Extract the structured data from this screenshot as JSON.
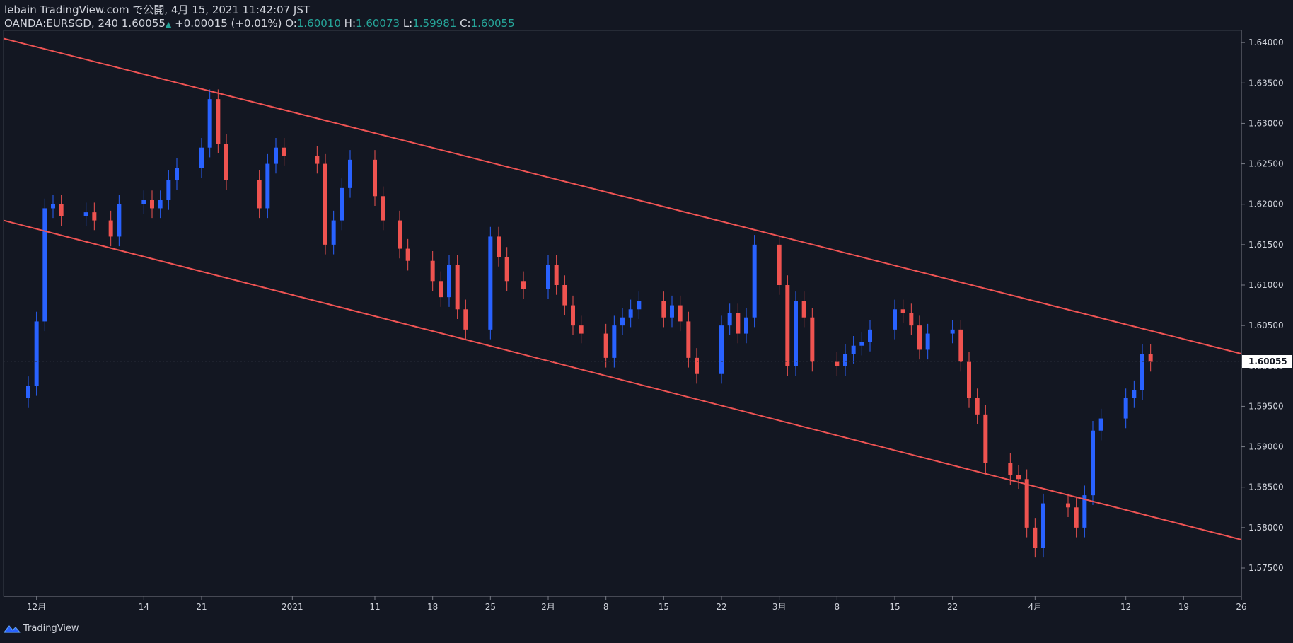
{
  "header": {
    "line1": "lebain TradingView.com で公開, 4月 15, 2021 11:42:07 JST",
    "symbol": "OANDA:EURSGD, 240",
    "last": "1.60055",
    "change": "+0.00015 (+0.01%)",
    "o_label": "O:",
    "o_value": "1.60010",
    "h_label": "H:",
    "h_value": "1.60073",
    "l_label": "L:",
    "l_value": "1.59981",
    "c_label": "C:",
    "c_value": "1.60055"
  },
  "footer": {
    "brand": "TradingView"
  },
  "colors": {
    "background": "#131722",
    "up": "#2962ff",
    "down": "#ef5350",
    "channel": "#f05454",
    "axis_text": "#d1d4dc",
    "price_tag": "#ffffff"
  },
  "chart_data": {
    "type": "line",
    "chart_style": "candlestick",
    "symbol": "OANDA:EURSGD",
    "timeframe": "240",
    "ylim": [
      1.5715,
      1.6415
    ],
    "y_ticks": [
      "1.64000",
      "1.63500",
      "1.63000",
      "1.62500",
      "1.62000",
      "1.61500",
      "1.61000",
      "1.60500",
      "1.60000",
      "1.59500",
      "1.59000",
      "1.58500",
      "1.58000",
      "1.57500"
    ],
    "y_tick_values": [
      1.64,
      1.635,
      1.63,
      1.625,
      1.62,
      1.615,
      1.61,
      1.605,
      1.6,
      1.595,
      1.59,
      1.585,
      1.58,
      1.575
    ],
    "x_ticks": [
      "12月",
      "14",
      "21",
      "2021",
      "11",
      "18",
      "25",
      "2月",
      "8",
      "15",
      "22",
      "3月",
      "8",
      "15",
      "22",
      "4月",
      "12",
      "19",
      "26"
    ],
    "x_tick_dates": [
      "2020-12-01",
      "2020-12-14",
      "2020-12-21",
      "2021-01-01",
      "2021-01-11",
      "2021-01-18",
      "2021-01-25",
      "2021-02-01",
      "2021-02-08",
      "2021-02-15",
      "2021-02-22",
      "2021-03-01",
      "2021-03-08",
      "2021-03-15",
      "2021-03-22",
      "2021-04-01",
      "2021-04-12",
      "2021-04-19",
      "2021-04-26"
    ],
    "current_price": "1.60055",
    "series": [
      {
        "name": "",
        "x": [
          "2020-11-30",
          "2020-12-01",
          "2020-12-02",
          "2020-12-03",
          "2020-12-04",
          "2020-12-07",
          "2020-12-08",
          "2020-12-10",
          "2020-12-11",
          "2020-12-14",
          "2020-12-15",
          "2020-12-16",
          "2020-12-17",
          "2020-12-18",
          "2020-12-21",
          "2020-12-22",
          "2020-12-23",
          "2020-12-24",
          "2020-12-28",
          "2020-12-29",
          "2020-12-30",
          "2020-12-31",
          "2021-01-04",
          "2021-01-05",
          "2021-01-06",
          "2021-01-07",
          "2021-01-08",
          "2021-01-11",
          "2021-01-12",
          "2021-01-14",
          "2021-01-15",
          "2021-01-18",
          "2021-01-19",
          "2021-01-20",
          "2021-01-21",
          "2021-01-22",
          "2021-01-25",
          "2021-01-26",
          "2021-01-27",
          "2021-01-29",
          "2021-02-01",
          "2021-02-02",
          "2021-02-03",
          "2021-02-04",
          "2021-02-05",
          "2021-02-08",
          "2021-02-09",
          "2021-02-10",
          "2021-02-11",
          "2021-02-12",
          "2021-02-15",
          "2021-02-16",
          "2021-02-17",
          "2021-02-18",
          "2021-02-19",
          "2021-02-22",
          "2021-02-23",
          "2021-02-24",
          "2021-02-25",
          "2021-02-26",
          "2021-03-01",
          "2021-03-02",
          "2021-03-03",
          "2021-03-04",
          "2021-03-05",
          "2021-03-08",
          "2021-03-09",
          "2021-03-10",
          "2021-03-11",
          "2021-03-12",
          "2021-03-15",
          "2021-03-16",
          "2021-03-17",
          "2021-03-18",
          "2021-03-19",
          "2021-03-22",
          "2021-03-23",
          "2021-03-24",
          "2021-03-25",
          "2021-03-26",
          "2021-03-29",
          "2021-03-30",
          "2021-03-31",
          "2021-04-01",
          "2021-04-02",
          "2021-04-05",
          "2021-04-06",
          "2021-04-07",
          "2021-04-08",
          "2021-04-09",
          "2021-04-12",
          "2021-04-13",
          "2021-04-14",
          "2021-04-15"
        ],
        "values": [
          1.5975,
          1.6055,
          1.6195,
          1.62,
          1.6185,
          1.619,
          1.618,
          1.616,
          1.62,
          1.6205,
          1.6195,
          1.6205,
          1.623,
          1.6245,
          1.627,
          1.633,
          1.6275,
          1.623,
          1.6195,
          1.625,
          1.627,
          1.626,
          1.625,
          1.615,
          1.618,
          1.622,
          1.6255,
          1.621,
          1.618,
          1.6145,
          1.613,
          1.6105,
          1.6085,
          1.6125,
          1.607,
          1.6045,
          1.616,
          1.6135,
          1.6105,
          1.6095,
          1.6125,
          1.61,
          1.6075,
          1.605,
          1.604,
          1.601,
          1.605,
          1.606,
          1.607,
          1.608,
          1.606,
          1.6075,
          1.6055,
          1.601,
          1.599,
          1.605,
          1.6065,
          1.604,
          1.606,
          1.615,
          1.61,
          1.6,
          1.608,
          1.606,
          1.6005,
          1.6,
          1.6015,
          1.6025,
          1.603,
          1.6045,
          1.607,
          1.6065,
          1.605,
          1.602,
          1.604,
          1.6045,
          1.6005,
          1.596,
          1.594,
          1.588,
          1.5865,
          1.586,
          1.58,
          1.5775,
          1.583,
          1.5825,
          1.58,
          1.584,
          1.592,
          1.5935,
          1.596,
          1.597,
          1.6015,
          1.6005
        ]
      }
    ],
    "annotations": [
      {
        "type": "trendline",
        "label": "channel-upper",
        "from": [
          "2020-11-27",
          1.6405
        ],
        "to": [
          "2021-04-26",
          1.6015
        ]
      },
      {
        "type": "trendline",
        "label": "channel-lower",
        "from": [
          "2020-11-27",
          1.618
        ],
        "to": [
          "2021-04-26",
          1.5785
        ]
      }
    ],
    "grid": false,
    "legend": "none"
  }
}
